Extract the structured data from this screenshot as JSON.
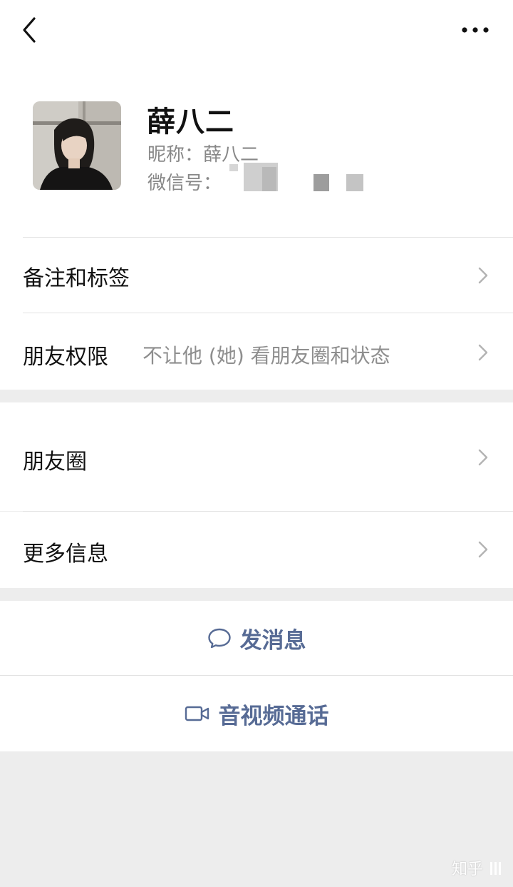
{
  "profile": {
    "name": "薛八二",
    "nickname_label": "昵称：",
    "nickname": "薛八二",
    "wechat_id_label": "微信号："
  },
  "menu": {
    "remarks_tags": "备注和标签",
    "friend_permissions": "朋友权限",
    "friend_permissions_value": "不让他 (她) 看朋友圈和状态",
    "moments": "朋友圈",
    "more_info": "更多信息"
  },
  "actions": {
    "send_message": "发消息",
    "video_call": "音视频通话"
  },
  "watermark": "知乎",
  "colors": {
    "accent": "#576b95",
    "background": "#ededed",
    "card": "#ffffff",
    "secondary_text": "#888888"
  },
  "icons": {
    "back": "back-arrow-icon",
    "more": "more-dots-icon",
    "chevron": "chevron-right-icon",
    "message": "chat-bubble-icon",
    "video": "video-camera-icon"
  }
}
